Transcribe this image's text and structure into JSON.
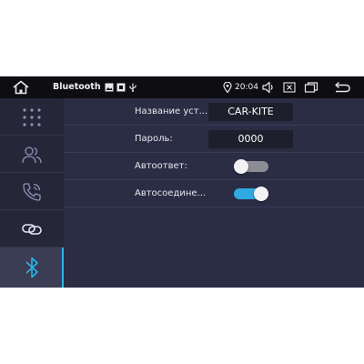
{
  "statusbar": {
    "title": "Bluetooth",
    "time": "20:04",
    "icons": [
      "home-icon",
      "image-icon",
      "notification-icon",
      "usb-icon",
      "location-icon",
      "volume-icon",
      "close-box-icon",
      "recent-apps-icon",
      "back-icon"
    ]
  },
  "sidebar": {
    "items": [
      {
        "icon": "keypad-icon",
        "active": false
      },
      {
        "icon": "contacts-icon",
        "active": false
      },
      {
        "icon": "call-log-icon",
        "active": false
      },
      {
        "icon": "pairing-link-icon",
        "active": false
      },
      {
        "icon": "bluetooth-icon",
        "active": true
      }
    ]
  },
  "settings": {
    "device_name_label": "Название уст...",
    "device_name_value": "CAR-KITE",
    "password_label": "Пароль:",
    "password_value": "0000",
    "auto_answer_label": "Автоответ:",
    "auto_answer_on": false,
    "auto_connect_label": "Автосоедине...",
    "auto_connect_on": true
  },
  "colors": {
    "accent": "#2fa9e2",
    "background": "#2b2d45",
    "sidebar": "#252738",
    "statusbar": "#0d0d12",
    "value_box": "#1e1f2c"
  }
}
